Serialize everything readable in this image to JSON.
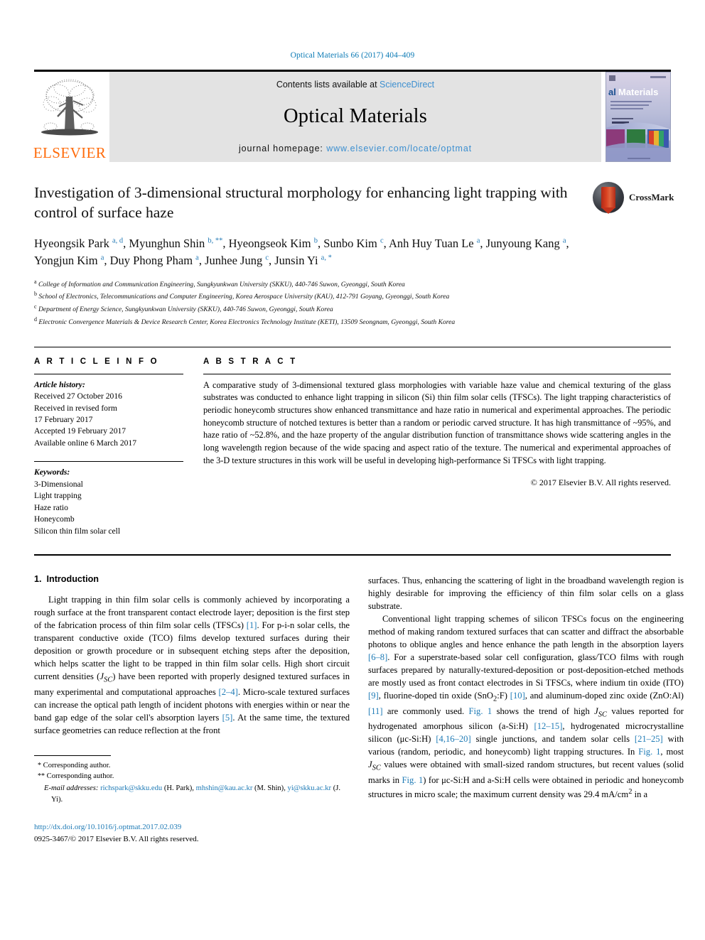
{
  "running_head": "Optical Materials 66 (2017) 404–409",
  "masthead": {
    "publisher_name": "ELSEVIER",
    "contents_prefix": "Contents lists available at ",
    "contents_link": "ScienceDirect",
    "journal_name": "Optical Materials",
    "homepage_prefix": "journal homepage: ",
    "homepage_url": "www.elsevier.com/locate/optmat",
    "cover_title": "Optical Materials"
  },
  "article": {
    "title": "Investigation of 3-dimensional structural morphology for enhancing light trapping with control of surface haze",
    "crossmark_label": "CrossMark",
    "authors_html": "Hyeongsik Park <sup class=\"aff\">a, d</sup>, Myunghun Shin <sup class=\"aff\">b, **</sup>, Hyeongseok Kim <sup class=\"aff\">b</sup>, Sunbo Kim <sup class=\"aff\">c</sup>, Anh Huy Tuan Le <sup class=\"aff\">a</sup>, Junyoung Kang <sup class=\"aff\">a</sup>, Yongjun Kim <sup class=\"aff\">a</sup>, Duy Phong Pham <sup class=\"aff\">a</sup>, Junhee Jung <sup class=\"aff\">c</sup>, Junsin Yi <sup class=\"aff\">a, *</sup>",
    "affiliations": [
      {
        "mark": "a",
        "text": "College of Information and Communication Engineering, Sungkyunkwan University (SKKU), 440-746 Suwon, Gyeonggi, South Korea"
      },
      {
        "mark": "b",
        "text": "School of Electronics, Telecommunications and Computer Engineering, Korea Aerospace University (KAU), 412-791 Goyang, Gyeonggi, South Korea"
      },
      {
        "mark": "c",
        "text": "Department of Energy Science, Sungkyunkwan University (SKKU), 440-746 Suwon, Gyeonggi, South Korea"
      },
      {
        "mark": "d",
        "text": "Electronic Convergence Materials & Device Research Center, Korea Electronics Technology Institute (KETI), 13509 Seongnam, Gyeonggi, South Korea"
      }
    ]
  },
  "article_info": {
    "heading": "A R T I C L E   I N F O",
    "history_label": "Article history:",
    "history": [
      "Received 27 October 2016",
      "Received in revised form",
      "17 February 2017",
      "Accepted 19 February 2017",
      "Available online 6 March 2017"
    ],
    "keywords_label": "Keywords:",
    "keywords": [
      "3-Dimensional",
      "Light trapping",
      "Haze ratio",
      "Honeycomb",
      "Silicon thin film solar cell"
    ]
  },
  "abstract": {
    "heading": "A B S T R A C T",
    "text": "A comparative study of 3-dimensional textured glass morphologies with variable haze value and chemical texturing of the glass substrates was conducted to enhance light trapping in silicon (Si) thin film solar cells (TFSCs). The light trapping characteristics of periodic honeycomb structures show enhanced transmittance and haze ratio in numerical and experimental approaches. The periodic honeycomb structure of notched textures is better than a random or periodic carved structure. It has high transmittance of ~95%, and haze ratio of ~52.8%, and the haze property of the angular distribution function of transmittance shows wide scattering angles in the long wavelength region because of the wide spacing and aspect ratio of the texture. The numerical and experimental approaches of the 3-D texture structures in this work will be useful in developing high-performance Si TFSCs with light trapping.",
    "copyright": "© 2017 Elsevier B.V. All rights reserved."
  },
  "body": {
    "section_number": "1.",
    "section_title": "Introduction",
    "left_paragraph_1_html": "Light trapping in thin film solar cells is commonly achieved by incorporating a rough surface at the front transparent contact electrode layer; deposition is the first step of the fabrication process of thin film solar cells (TFSCs) <span class=\"ref\">[1]</span>. For p-i-n solar cells, the transparent conductive oxide (TCO) films develop textured surfaces during their deposition or growth procedure or in subsequent etching steps after the deposition, which helps scatter the light to be trapped in thin film solar cells. High short circuit current densities (<i>J<sub>SC</sub></i>) have been reported with properly designed textured surfaces in many experimental and computational approaches <span class=\"ref\">[2–4]</span>. Micro-scale textured surfaces can increase the optical path length of incident photons with energies within or near the band gap edge of the solar cell's absorption layers <span class=\"ref\">[5]</span>. At the same time, the textured surface geometries can reduce reflection at the front",
    "right_paragraph_1_html": "surfaces. Thus, enhancing the scattering of light in the broadband wavelength region is highly desirable for improving the efficiency of thin film solar cells on a glass substrate.",
    "right_paragraph_2_html": "Conventional light trapping schemes of silicon TFSCs focus on the engineering method of making random textured surfaces that can scatter and diffract the absorbable photons to oblique angles and hence enhance the path length in the absorption layers <span class=\"ref\">[6–8]</span>. For a superstrate-based solar cell configuration, glass/TCO films with rough surfaces prepared by naturally-textured-deposition or post-deposition-etched methods are mostly used as front contact electrodes in Si TFSCs, where indium tin oxide (ITO) <span class=\"ref\">[9]</span>, fluorine-doped tin oxide (SnO<sub>2</sub>:F) <span class=\"ref\">[10]</span>, and aluminum-doped zinc oxide (ZnO:Al) <span class=\"ref\">[11]</span> are commonly used. <span class=\"ref\">Fig. 1</span> shows the trend of high <i>J<sub>SC</sub></i> values reported for hydrogenated amorphous silicon (a-Si:H) <span class=\"ref\">[12–15]</span>, hydrogenated microcrystalline silicon (μc-Si:H) <span class=\"ref\">[4,16–20]</span> single junctions, and tandem solar cells <span class=\"ref\">[21–25]</span> with various (random, periodic, and honeycomb) light trapping structures. In <span class=\"ref\">Fig. 1</span>, most <i>J<sub>SC</sub></i> values were obtained with small-sized random structures, but recent values (solid marks in <span class=\"ref\">Fig. 1</span>) for μc-Si:H and a-Si:H cells were obtained in periodic and honeycomb structures in micro scale; the maximum current density was 29.4 mA/cm<sup>2</sup> in a"
  },
  "footer": {
    "corresponding_1": "Corresponding author.",
    "corresponding_2": "Corresponding author.",
    "email_label": "E-mail addresses:",
    "emails_html": "<span class=\"lnk\">richspark@skku.edu</span> (H. Park), <span class=\"lnk\">mhshin@kau.ac.kr</span> (M. Shin), <span class=\"lnk\">yi@skku.ac.kr</span> (J. Yi).",
    "doi": "http://dx.doi.org/10.1016/j.optmat.2017.02.039",
    "issn_line": "0925-3467/© 2017 Elsevier B.V. All rights reserved."
  },
  "colors": {
    "link_blue": "#1f7bb6",
    "sciencedirect_blue": "#3c8fd0",
    "elsevier_orange": "#ff6c0c",
    "band_gray": "#e3e3e3"
  }
}
